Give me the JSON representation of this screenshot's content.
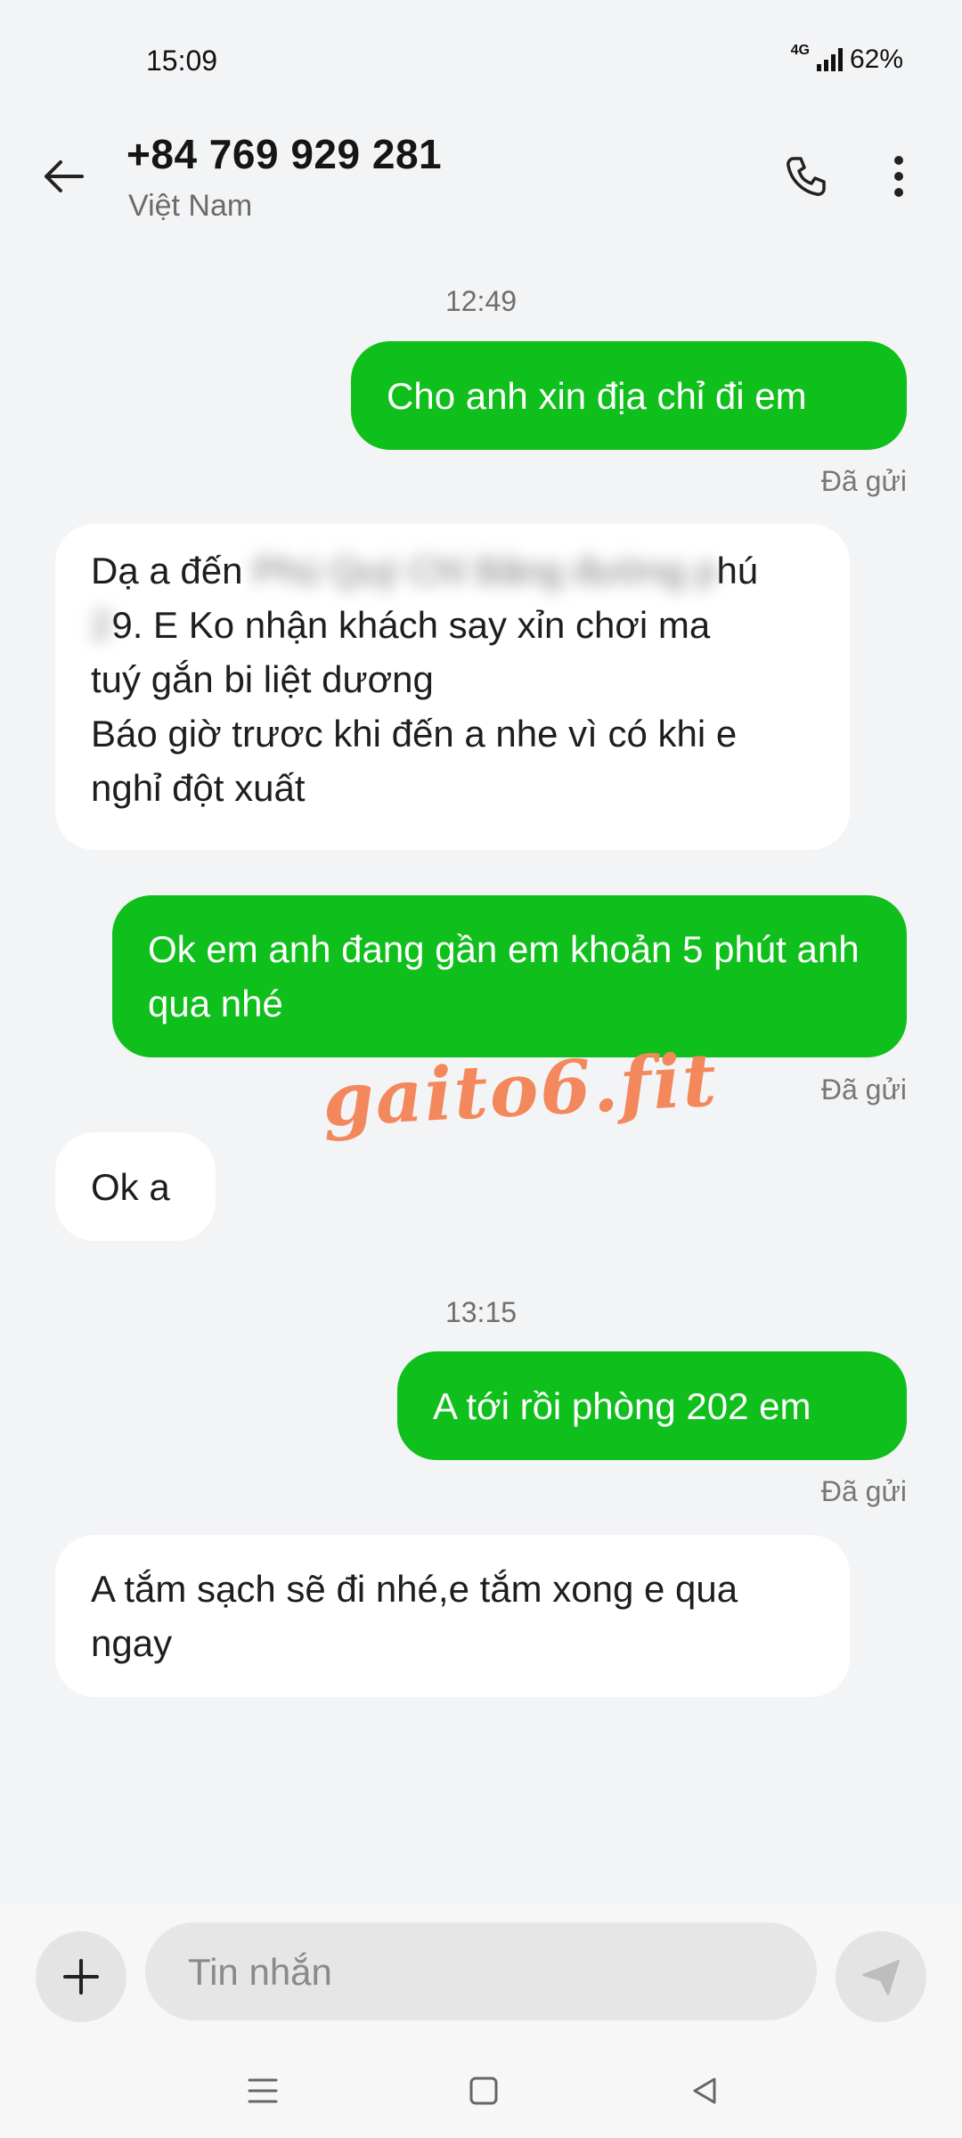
{
  "status_bar": {
    "time": "15:09",
    "network": "4G",
    "battery": "62%"
  },
  "header": {
    "contact_name": "+84 769 929 281",
    "contact_subtitle": "Việt Nam",
    "back_icon": "arrow-left-icon",
    "call_icon": "phone-icon",
    "more_icon": "more-vertical-icon"
  },
  "conversation": {
    "time_1": "12:49",
    "msg_1": "Cho anh xin địa chỉ đi em",
    "msg_1_status": "Đã gửi",
    "msg_2_line1_visible": "Dạ a đến",
    "msg_2_line1_tail": "hú",
    "msg_2_line2_tail": "9. E Ko nhận khách say xỉn chơi ma",
    "msg_2_line3": "tuý gắn bi liệt dương",
    "msg_2_line4": "Báo giờ trươc khi đến a nhe vì có khi e",
    "msg_2_line5": "nghỉ đột xuất",
    "msg_3": "Ok em anh đang gần em khoản 5 phút anh qua nhé",
    "msg_3_status": "Đã gửi",
    "msg_4": "Ok a",
    "time_2": "13:15",
    "msg_5": "A tới rồi phòng 202 em",
    "msg_5_status": "Đã gửi",
    "msg_6": "A tắm sạch sẽ đi nhé,e tắm xong e qua ngay"
  },
  "watermark": "gaito6.fit",
  "composer": {
    "placeholder": "Tin nhắn"
  },
  "colors": {
    "outgoing_bubble": "#0fbf1b",
    "incoming_bubble": "#ffffff",
    "background": "#f3f4f6",
    "watermark": "#f3885d"
  }
}
